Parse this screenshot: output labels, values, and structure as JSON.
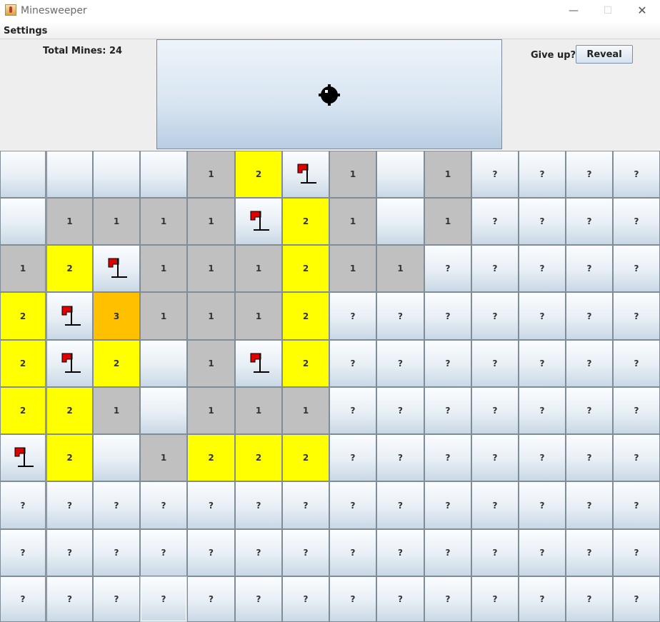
{
  "window": {
    "title": "Minesweeper",
    "min": "—",
    "max": "☐",
    "close": "✕"
  },
  "menu": {
    "settings": "Settings"
  },
  "top": {
    "mines_label": "Total Mines: 24",
    "give_up": "Give up?",
    "reveal_label": "Reveal"
  },
  "board": {
    "rows": [
      [
        "E",
        "E",
        "E",
        "E",
        "1g",
        "2y",
        "F",
        "1g",
        "E",
        "1g",
        "?",
        "?",
        "?",
        "?"
      ],
      [
        "E",
        "1g",
        "1g",
        "1g",
        "1g",
        "F",
        "2y",
        "1g",
        "E",
        "1g",
        "?",
        "?",
        "?",
        "?"
      ],
      [
        "1g",
        "2y",
        "F",
        "1g",
        "1g",
        "1g",
        "2y",
        "1g",
        "1g",
        "?",
        "?",
        "?",
        "?",
        "?"
      ],
      [
        "2y",
        "F",
        "3o",
        "1g",
        "1g",
        "1g",
        "2y",
        "?",
        "?",
        "?",
        "?",
        "?",
        "?",
        "?"
      ],
      [
        "2y",
        "F",
        "2y",
        "E",
        "1g",
        "F",
        "2y",
        "?",
        "?",
        "?",
        "?",
        "?",
        "?",
        "?"
      ],
      [
        "2y",
        "2y",
        "1g",
        "E",
        "1g",
        "1g",
        "1g",
        "?",
        "?",
        "?",
        "?",
        "?",
        "?",
        "?"
      ],
      [
        "F",
        "2y",
        "E",
        "1g",
        "2y",
        "2y",
        "2y",
        "?",
        "?",
        "?",
        "?",
        "?",
        "?",
        "?"
      ],
      [
        "?",
        "?",
        "?",
        "?",
        "?",
        "?",
        "?",
        "?",
        "?",
        "?",
        "?",
        "?",
        "?",
        "?"
      ],
      [
        "?",
        "?",
        "?",
        "?",
        "?",
        "?",
        "?",
        "?",
        "?",
        "?",
        "?",
        "?",
        "?",
        "?"
      ],
      [
        "?",
        "?",
        "?",
        "S?",
        "?",
        "?",
        "?",
        "?",
        "?",
        "?",
        "?",
        "?",
        "?",
        "?"
      ]
    ]
  },
  "colors": {
    "revealed_gray": "#c0c0c0",
    "warning_yellow": "#ffff00",
    "danger_orange": "#ffc000",
    "flag_red": "#e00000"
  },
  "icons": {
    "face": "bomb-icon",
    "flag": "flag-icon",
    "app": "java-cup-icon"
  }
}
